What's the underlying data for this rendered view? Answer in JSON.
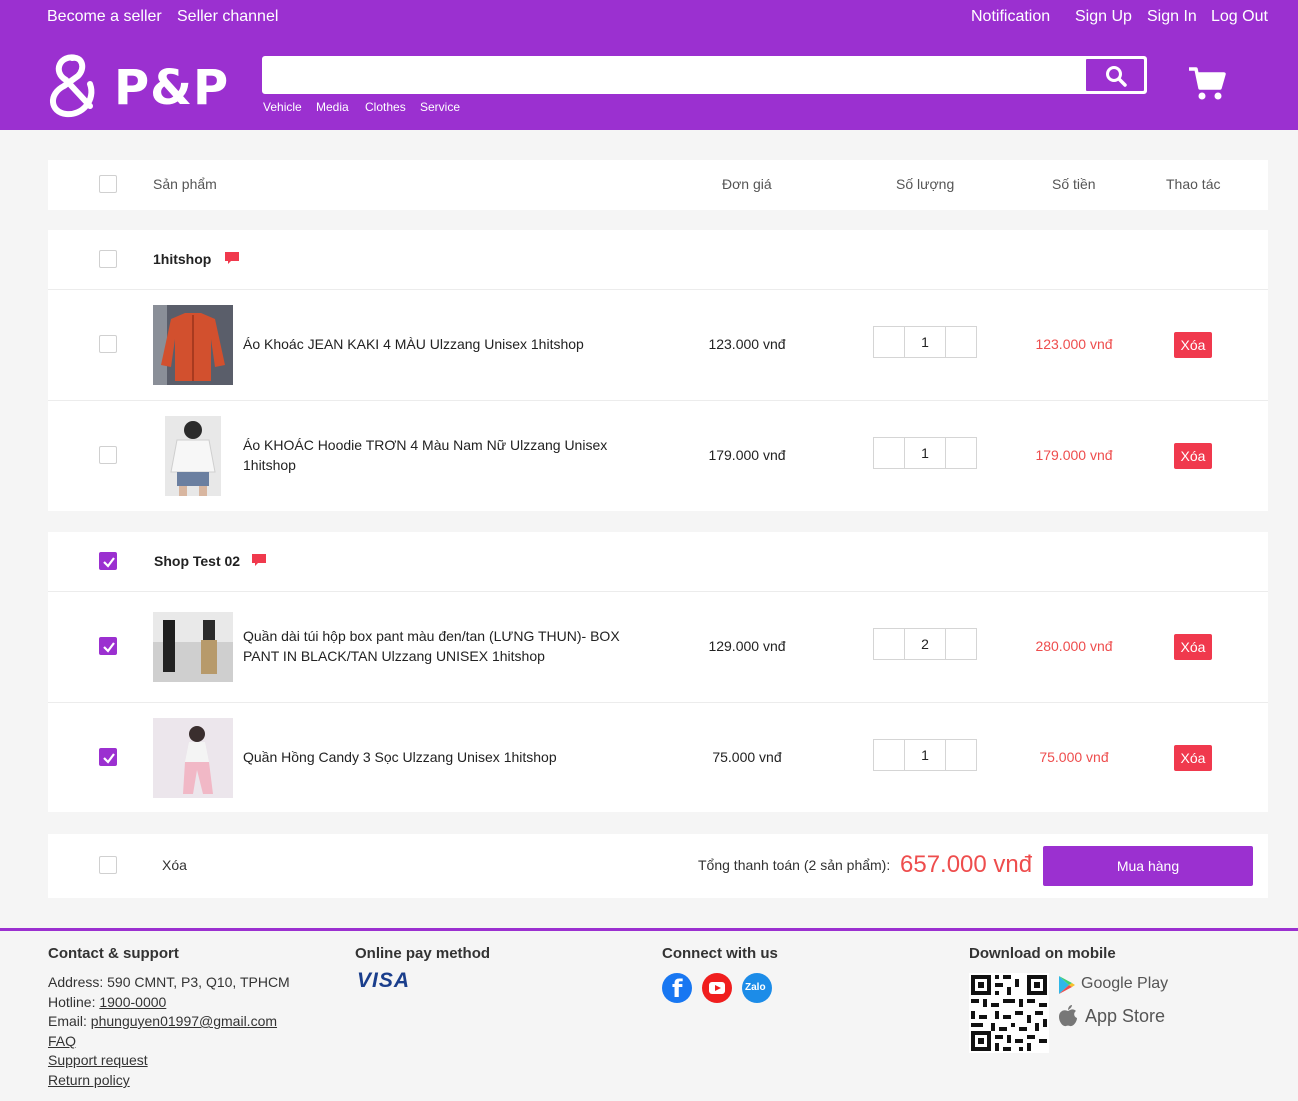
{
  "topbar": {
    "become_seller": "Become a seller",
    "seller_channel": "Seller channel",
    "notification": "Notification",
    "sign_up": "Sign Up",
    "sign_in": "Sign In",
    "log_out": "Log Out"
  },
  "brand": {
    "name": "P&P",
    "color": "#9b30d0"
  },
  "search": {
    "value": "",
    "placeholder": "",
    "icon": "search-icon"
  },
  "categories": [
    "Vehicle",
    "Media",
    "Clothes",
    "Service"
  ],
  "cart": {
    "headers": {
      "product": "Sản phẩm",
      "unit_price": "Đơn giá",
      "quantity": "Số lượng",
      "amount": "Số tiền",
      "action": "Thao tác"
    }
  },
  "shops": [
    {
      "name": "1hitshop",
      "checked": false,
      "items": [
        {
          "name_line1": "Áo Khoác JEAN KAKI 4 MÀU Ulzzang Unisex 1hitshop",
          "name_line2": "",
          "price": "123.000 vnđ",
          "qty": "1",
          "total": "123.000 vnđ",
          "action": "Xóa",
          "checked": false
        },
        {
          "name_line1": "Áo KHOÁC Hoodie TRƠN 4 Màu Nam Nữ Ulzzang Unisex",
          "name_line2": "1hitshop",
          "price": "179.000 vnđ",
          "qty": "1",
          "total": "179.000 vnđ",
          "action": "Xóa",
          "checked": false
        }
      ]
    },
    {
      "name": "Shop Test 02",
      "checked": true,
      "items": [
        {
          "name_line1": "Quần dài túi hộp box pant màu đen/tan (LƯNG THUN)- BOX",
          "name_line2": "PANT IN BLACK/TAN Ulzzang UNISEX 1hitshop",
          "price": "129.000 vnđ",
          "qty": "2",
          "total": "280.000 vnđ",
          "action": "Xóa",
          "checked": true
        },
        {
          "name_line1": "Quần Hồng Candy 3 Sọc Ulzzang Unisex 1hitshop",
          "name_line2": "",
          "price": "75.000 vnđ",
          "qty": "1",
          "total": "75.000 vnđ",
          "action": "Xóa",
          "checked": true
        }
      ]
    }
  ],
  "summary": {
    "delete_label": "Xóa",
    "total_label": "Tổng thanh toán (2 sản phẩm):",
    "total_value": "657.000 vnđ",
    "buy_label": "Mua hàng"
  },
  "footer": {
    "contact": {
      "title": "Contact & support",
      "address": "Address: 590 CMNT, P3, Q10, TPHCM",
      "hotline_label": "Hotline: ",
      "hotline": "1900-0000",
      "email_label": "Email: ",
      "email": "phunguyen01997@gmail.com",
      "faq": "FAQ",
      "support": "Support request",
      "return": "Return policy"
    },
    "pay": {
      "title": "Online pay method",
      "visa": "VISA"
    },
    "connect": {
      "title": "Connect with us",
      "zalo": "Zalo"
    },
    "download": {
      "title": "Download on mobile",
      "google_play": "Google Play",
      "app_store": "App Store"
    }
  }
}
